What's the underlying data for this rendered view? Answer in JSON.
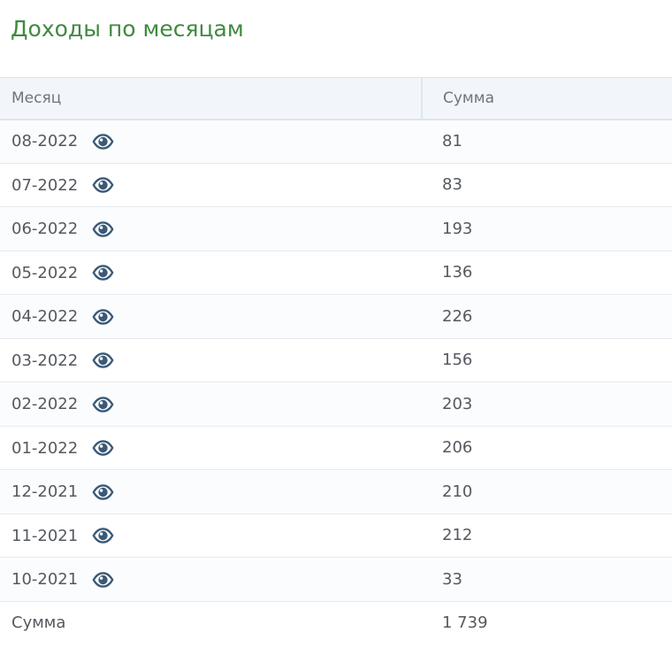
{
  "title": "Доходы по месяцам",
  "table": {
    "headers": {
      "month": "Месяц",
      "sum": "Сумма"
    },
    "rows": [
      {
        "month": "08-2022",
        "amount": "81"
      },
      {
        "month": "07-2022",
        "amount": "83"
      },
      {
        "month": "06-2022",
        "amount": "193"
      },
      {
        "month": "05-2022",
        "amount": "136"
      },
      {
        "month": "04-2022",
        "amount": "226"
      },
      {
        "month": "03-2022",
        "amount": "156"
      },
      {
        "month": "02-2022",
        "amount": "203"
      },
      {
        "month": "01-2022",
        "amount": "206"
      },
      {
        "month": "12-2021",
        "amount": "210"
      },
      {
        "month": "11-2021",
        "amount": "212"
      },
      {
        "month": "10-2021",
        "amount": "33"
      }
    ],
    "footer": {
      "label": "Сумма",
      "total": "1 739"
    }
  },
  "icons": {
    "row_action": "eye-icon"
  },
  "colors": {
    "title": "#3f8a3f",
    "header_bg": "#f2f6fb",
    "icon": "#3b5a78",
    "text": "#55595f"
  }
}
